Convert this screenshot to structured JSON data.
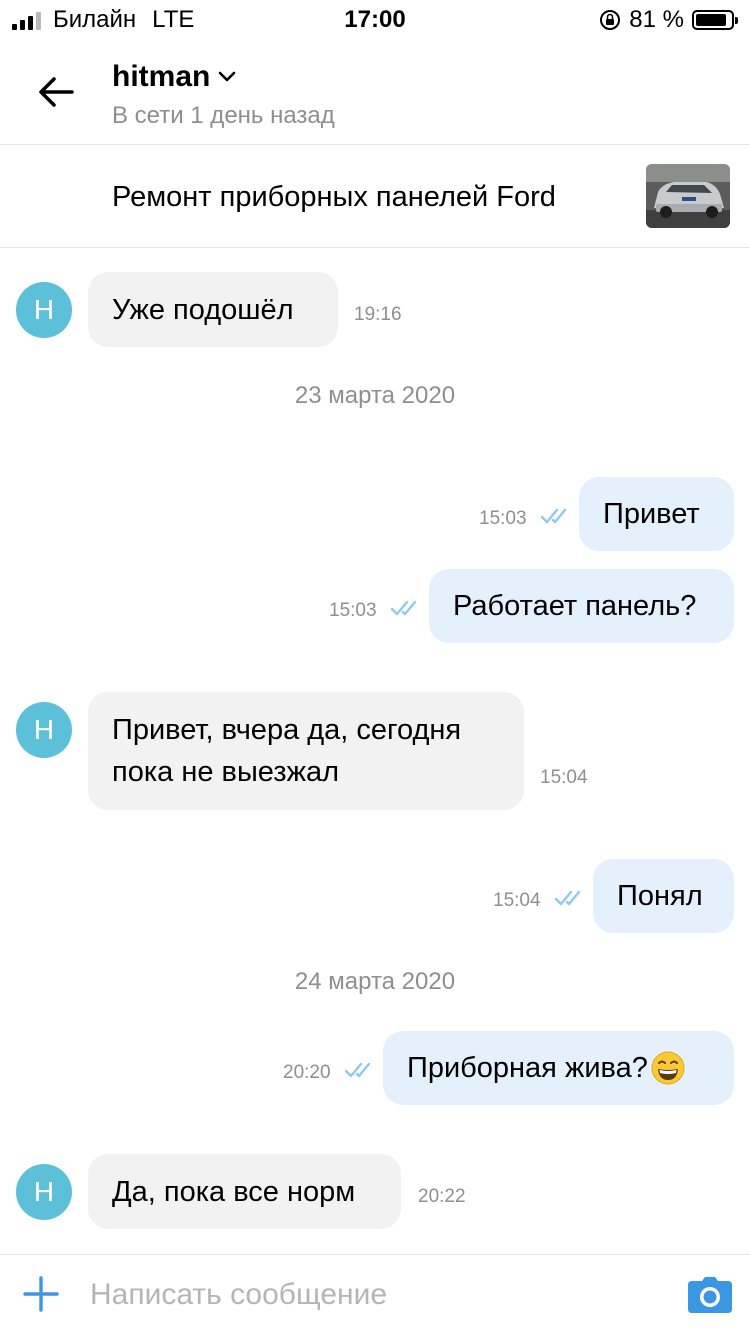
{
  "status_bar": {
    "carrier": "Билайн",
    "network": "LTE",
    "time": "17:00",
    "battery": "81 %",
    "battery_level": 0.81
  },
  "header": {
    "name": "hitman",
    "status": "В сети 1 день назад",
    "back_icon": "arrow-left-icon",
    "dropdown_icon": "chevron-down-icon"
  },
  "ad": {
    "title": "Ремонт приборных панелей Ford"
  },
  "messages": [
    {
      "dir": "in",
      "avatar": "H",
      "text": "Уже подошёл",
      "time": "19:16"
    },
    {
      "date": "23 марта 2020"
    },
    {
      "dir": "out",
      "text": "Привет",
      "time": "15:03"
    },
    {
      "dir": "out",
      "text": "Работает панель?",
      "time": "15:03"
    },
    {
      "dir": "in",
      "avatar": "H",
      "text_line1": "Привет, вчера да, сегодня",
      "text_line2": "пока не выезжал",
      "time": "15:04"
    },
    {
      "dir": "out",
      "text": "Понял",
      "time": "15:04"
    },
    {
      "date": "24 марта 2020"
    },
    {
      "dir": "out",
      "text": "Приборная жива?",
      "emoji": "grinning-face-icon",
      "time": "20:20"
    },
    {
      "dir": "in",
      "avatar": "H",
      "text": "Да, пока все норм",
      "time": "20:22"
    }
  ],
  "composer": {
    "placeholder": "Написать сообщение",
    "plus_icon": "plus-icon",
    "camera_icon": "camera-icon"
  },
  "colors": {
    "accent": "#3c97e3",
    "avatar": "#5bc0d8",
    "incoming_bubble": "#f2f2f2",
    "outgoing_bubble": "#e4f1fd",
    "read_ticks": "#8ccaf2"
  }
}
